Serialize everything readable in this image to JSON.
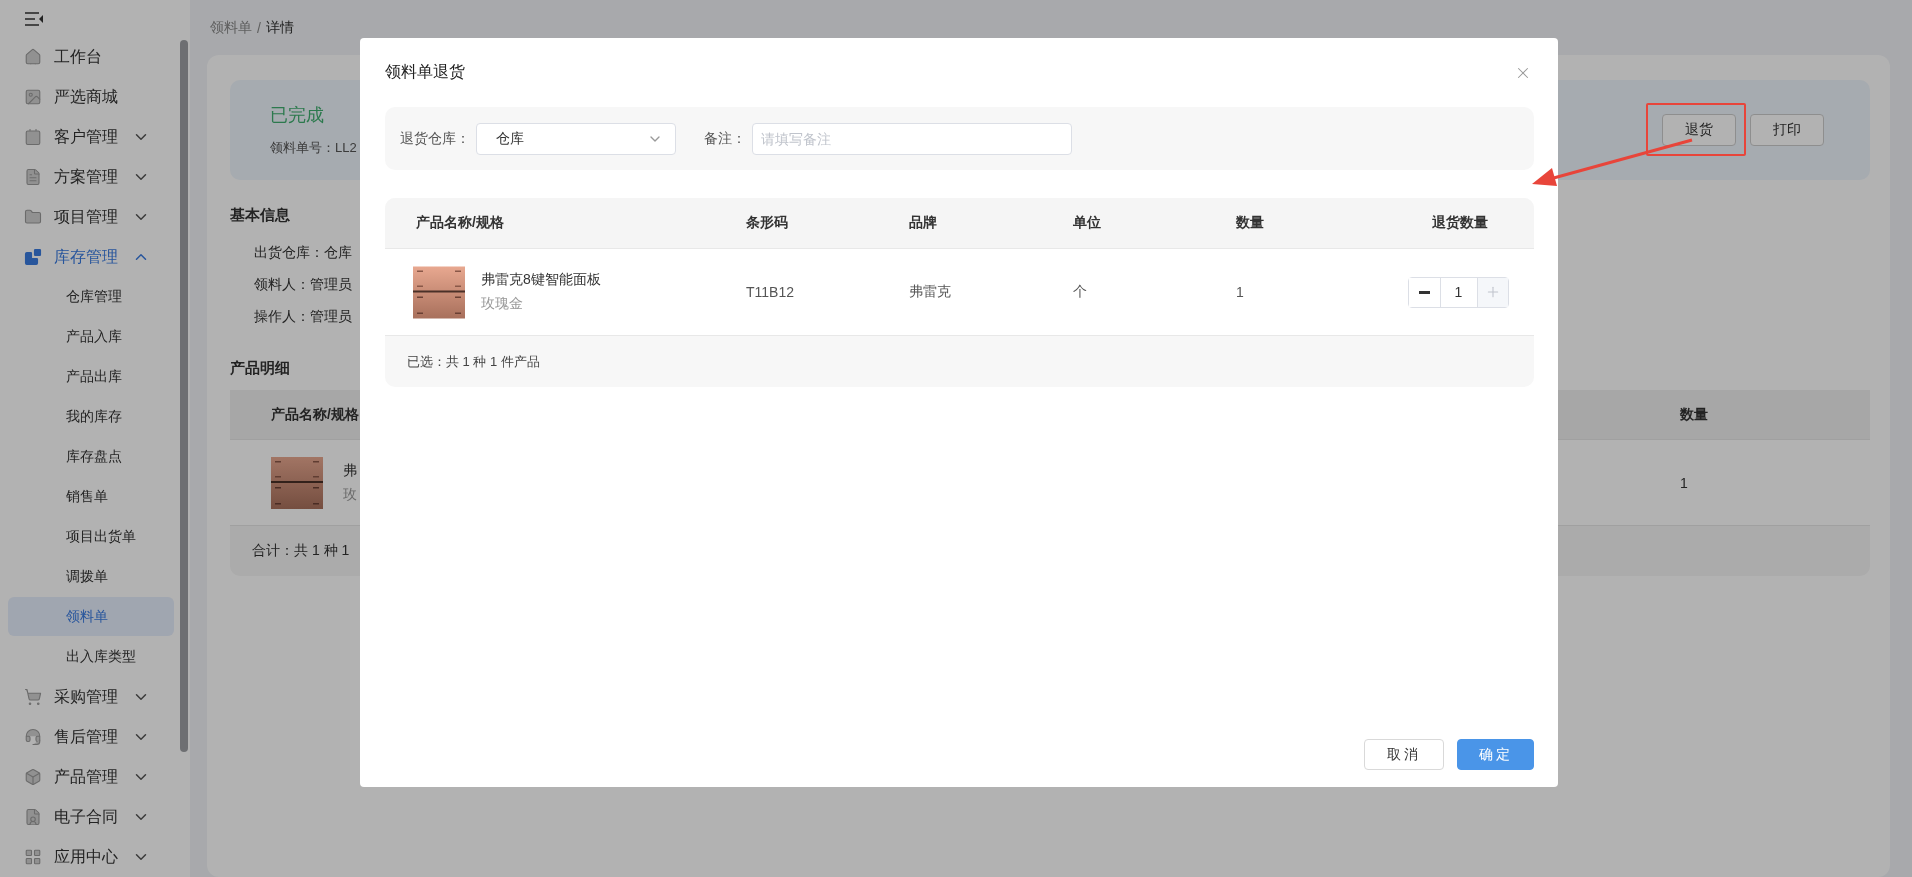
{
  "sidebar": {
    "items": [
      {
        "label": "工作台",
        "kind": "link",
        "selected": false
      },
      {
        "label": "严选商城",
        "kind": "link",
        "selected": false
      },
      {
        "label": "客户管理",
        "kind": "group",
        "expanded": false,
        "selected": false
      },
      {
        "label": "方案管理",
        "kind": "group",
        "expanded": false,
        "selected": false
      },
      {
        "label": "项目管理",
        "kind": "group",
        "expanded": false,
        "selected": false
      },
      {
        "label": "库存管理",
        "kind": "group",
        "expanded": true,
        "selected": true,
        "children": [
          {
            "label": "仓库管理",
            "selected": false
          },
          {
            "label": "产品入库",
            "selected": false
          },
          {
            "label": "产品出库",
            "selected": false
          },
          {
            "label": "我的库存",
            "selected": false
          },
          {
            "label": "库存盘点",
            "selected": false
          },
          {
            "label": "销售单",
            "selected": false
          },
          {
            "label": "项目出货单",
            "selected": false
          },
          {
            "label": "调拨单",
            "selected": false
          },
          {
            "label": "领料单",
            "selected": true
          },
          {
            "label": "出入库类型",
            "selected": false
          }
        ]
      },
      {
        "label": "采购管理",
        "kind": "group",
        "expanded": false,
        "selected": false
      },
      {
        "label": "售后管理",
        "kind": "group",
        "expanded": false,
        "selected": false
      },
      {
        "label": "产品管理",
        "kind": "group",
        "expanded": false,
        "selected": false
      },
      {
        "label": "电子合同",
        "kind": "group",
        "expanded": false,
        "selected": false
      },
      {
        "label": "应用中心",
        "kind": "group",
        "expanded": false,
        "selected": false
      }
    ]
  },
  "breadcrumb": {
    "items": [
      "领料单",
      "详情"
    ],
    "separator": "/"
  },
  "detail": {
    "status": "已完成",
    "order_no": "领料单号：LL2",
    "buttons": [
      "退货",
      "打印"
    ],
    "basic_info": {
      "title": "基本信息",
      "fields": [
        "出货仓库：仓库",
        "领料人：管理员",
        "操作人：管理员"
      ]
    },
    "products": {
      "title": "产品明细",
      "columns": [
        "产品名称/规格",
        "数量"
      ],
      "rows": [
        {
          "name": "弗",
          "spec": "玫",
          "quantity": "1"
        }
      ],
      "footer": "合计：共 1 种 1"
    }
  },
  "dialog": {
    "title": "领料单退货",
    "filters": {
      "warehouse_label": "退货仓库：",
      "warehouse_value": "仓库",
      "remark_label": "备注：",
      "remark_placeholder": "请填写备注"
    },
    "table": {
      "columns": [
        "产品名称/规格",
        "条形码",
        "品牌",
        "单位",
        "数量",
        "退货数量"
      ],
      "rows": [
        {
          "name": "弗雷克8键智能面板",
          "spec": "玫瑰金",
          "barcode": "T11B12",
          "brand": "弗雷克",
          "unit": "个",
          "quantity": "1",
          "return_quantity": "1",
          "minus_disabled": false,
          "plus_disabled": true
        }
      ],
      "footer": "已选：共 1 种 1 件产品"
    },
    "buttons": [
      {
        "label": "取消",
        "kind": "default"
      },
      {
        "label": "确定",
        "kind": "primary"
      }
    ]
  }
}
